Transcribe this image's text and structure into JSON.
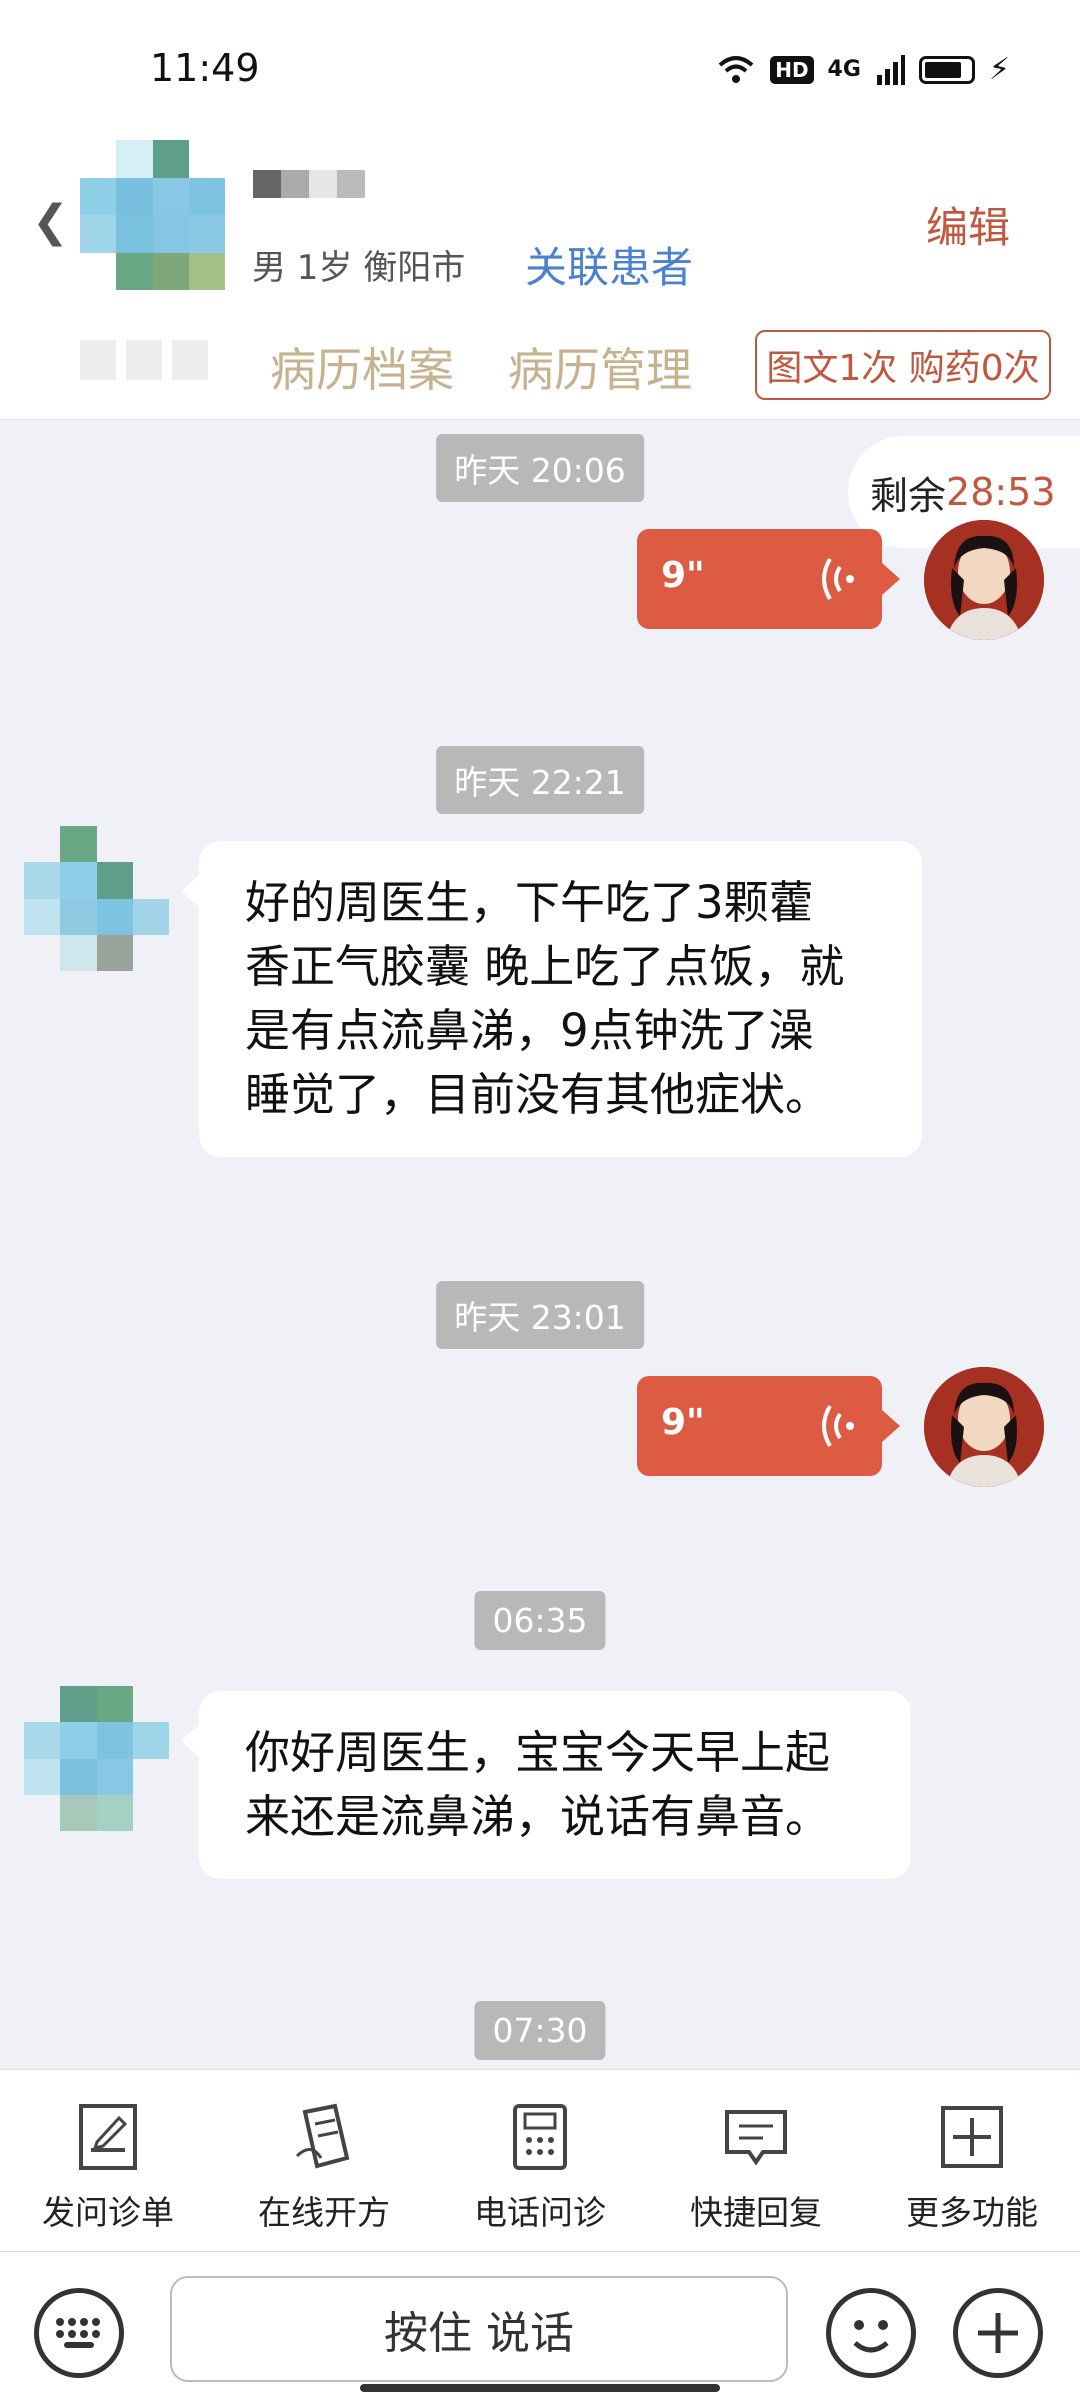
{
  "status_bar": {
    "time": "11:49",
    "hd": "HD",
    "network": "4G"
  },
  "header": {
    "patient_meta": "男 1岁  衡阳市",
    "link_patient": "关联患者",
    "edit": "编辑",
    "tabs": [
      "病历档案",
      "病历管理"
    ],
    "count_badge": "图文1次 购药0次"
  },
  "timer": {
    "label": "剩余",
    "value": "28:53"
  },
  "messages": {
    "ts1": "昨天 20:06",
    "voice1": "9\"",
    "ts2": "昨天 22:21",
    "text1_lines": [
      "好的周医生，下午吃了3颗藿",
      "香正气胶囊 晚上吃了点饭，就",
      "是有点流鼻涕，9点钟洗了澡",
      "睡觉了，目前没有其他症状。"
    ],
    "ts3": "昨天 23:01",
    "voice2": "9\"",
    "ts4": "06:35",
    "text2_lines": [
      "你好周医生，宝宝今天早上起",
      "来还是流鼻涕，说话有鼻音。"
    ],
    "ts5": "07:30"
  },
  "toolbar": {
    "items": [
      {
        "label": "发问诊单",
        "icon": "form-icon"
      },
      {
        "label": "在线开方",
        "icon": "prescription-icon"
      },
      {
        "label": "电话问诊",
        "icon": "phone-icon"
      },
      {
        "label": "快捷回复",
        "icon": "quick-reply-icon"
      },
      {
        "label": "更多功能",
        "icon": "more-icon"
      }
    ]
  },
  "input": {
    "hold_to_talk": "按住 说话"
  },
  "colors": {
    "accent": "#de5b43",
    "link": "#4a82cf",
    "tab": "#c7b28f"
  }
}
